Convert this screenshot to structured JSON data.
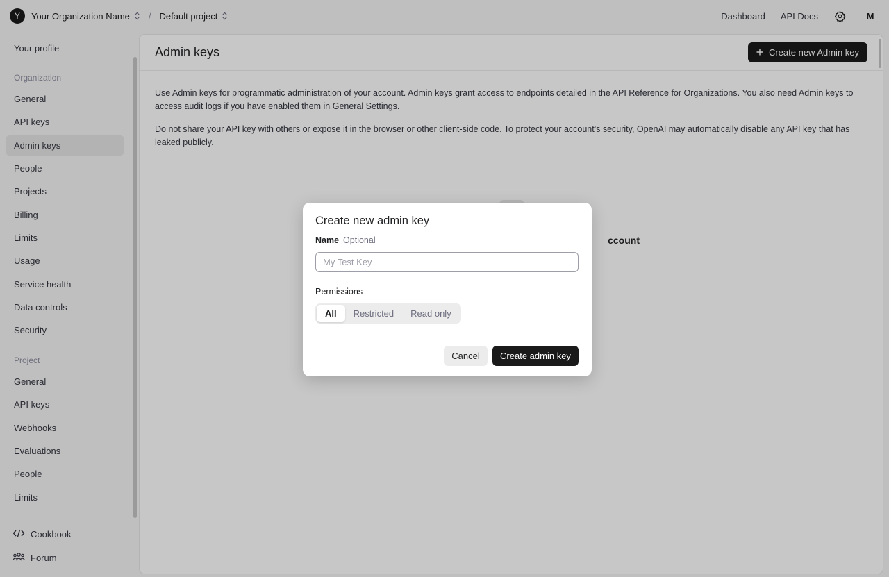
{
  "topbar": {
    "org_initial": "Y",
    "org_name": "Your Organization Name",
    "separator": "/",
    "project_name": "Default project",
    "links": [
      "Dashboard",
      "API Docs"
    ],
    "user_initial": "M"
  },
  "sidebar": {
    "profile": "Your profile",
    "org_section": "Organization",
    "org_items": [
      "General",
      "API keys",
      "Admin keys",
      "People",
      "Projects",
      "Billing",
      "Limits",
      "Usage",
      "Service health",
      "Data controls",
      "Security"
    ],
    "project_section": "Project",
    "project_items": [
      "General",
      "API keys",
      "Webhooks",
      "Evaluations",
      "People",
      "Limits"
    ],
    "footer": {
      "cookbook": "Cookbook",
      "forum": "Forum"
    },
    "active": "Admin keys"
  },
  "main": {
    "title": "Admin keys",
    "new_key_button": "Create new Admin key",
    "para1_a": "Use Admin keys for programmatic administration of your account. Admin keys grant access to endpoints detailed in the ",
    "para1_link1": "API Reference for Organizations",
    "para1_b": ". You also need Admin keys to access audit logs if you have enabled them in ",
    "para1_link2": "General Settings",
    "para1_c": ".",
    "para2": "Do not share your API key with others or expose it in the browser or other client-side code. To protect your account's security, OpenAI may automatically disable any API key that has leaked publicly.",
    "empty_partial": "ccount"
  },
  "modal": {
    "title": "Create new admin key",
    "name_label": "Name",
    "name_optional": "Optional",
    "name_placeholder": "My Test Key",
    "name_value": "",
    "permissions_label": "Permissions",
    "permissions": [
      "All",
      "Restricted",
      "Read only"
    ],
    "permissions_selected": "All",
    "cancel": "Cancel",
    "create": "Create admin key"
  },
  "colors": {
    "primary_button": "#1a1a1a",
    "overlay": "rgba(0,0,0,0.22)"
  }
}
